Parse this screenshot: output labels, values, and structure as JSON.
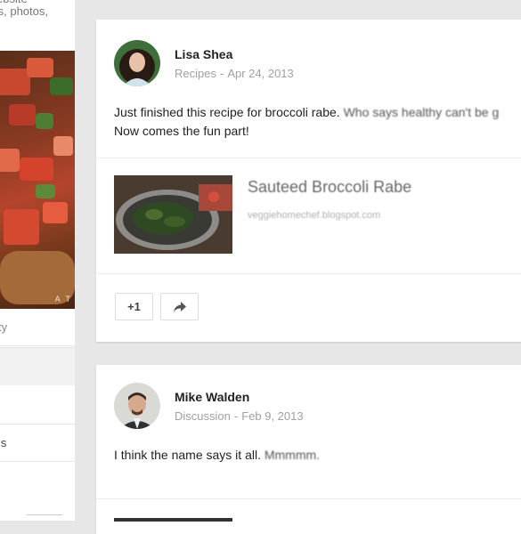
{
  "left_column": {
    "snippet_line1": "ebsite",
    "snippet_line2": "ts, photos,",
    "photo_watermark": "A T",
    "label": "ty",
    "item": "ls"
  },
  "posts": [
    {
      "author": "Lisa Shea",
      "category": "Recipes",
      "date": "Apr 24, 2013",
      "text_line1_a": "Just finished this recipe for broccoli rabe.",
      "text_line1_b": "Who says healthy can't be g",
      "text_line2": "Now comes the fun part!",
      "link": {
        "title": "Sauteed Broccoli Rabe",
        "url": "veggiehomechef.blogspot.com"
      },
      "plus_one_label": "+1",
      "share_icon": "share-arrow-icon"
    },
    {
      "author": "Mike Walden",
      "category": "Discussion",
      "date": "Feb 9, 2013",
      "text_a": "I think the name says it all.",
      "text_b": "Mmmmm."
    }
  ],
  "separator": "-",
  "colors": {
    "background": "#e7e7e7",
    "card": "#ffffff",
    "meta_gray": "#a0a0a0"
  }
}
